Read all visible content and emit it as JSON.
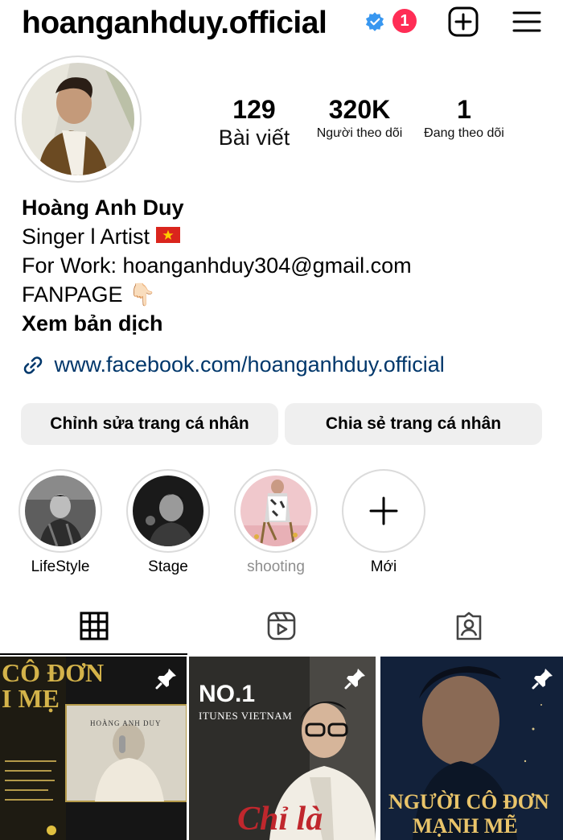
{
  "header": {
    "username": "hoanganhduy.official",
    "notification_count": "1"
  },
  "stats": {
    "posts_count": "129",
    "posts_label": "Bài viết",
    "followers_count": "320K",
    "followers_label": "Người theo dõi",
    "following_count": "1",
    "following_label": "Đang theo dõi"
  },
  "bio": {
    "name": "Hoàng Anh Duy",
    "line1": "Singer l Artist",
    "line2": "For Work: hoanganhduy304@gmail.com",
    "line3": "FANPAGE 👇🏻",
    "translate": "Xem bản dịch"
  },
  "link": {
    "text": "www.facebook.com/hoanganhduy.official"
  },
  "buttons": {
    "edit_profile": "Chỉnh sửa trang cá nhân",
    "share_profile": "Chia sẻ trang cá nhân"
  },
  "highlights": [
    {
      "label": "LifeStyle"
    },
    {
      "label": "Stage"
    },
    {
      "label": "shooting"
    },
    {
      "label": "Mới"
    }
  ],
  "posts": [
    {
      "title_top": "CÔ ĐƠN",
      "title_bottom": "I MẸ",
      "artist": "HOÀNG ANH DUY",
      "pinned": true
    },
    {
      "badge": "NO.1",
      "subtitle": "ITUNES VIETNAM",
      "title": "Chỉ là",
      "pinned": true
    },
    {
      "title": "NGƯỜI CÔ ĐƠN",
      "subtitle": "MẠNH MẼ",
      "pinned": true
    }
  ],
  "colors": {
    "link": "#00376b",
    "notification": "#ff2d55",
    "verified": "#3897f0",
    "button_bg": "#efefef"
  }
}
